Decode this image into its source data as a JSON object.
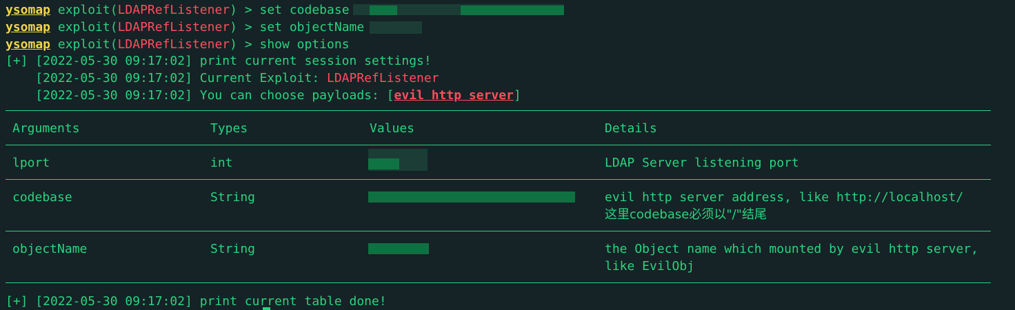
{
  "prompt": "ysomap",
  "commands": [
    {
      "pre": " exploit(",
      "module": "LDAPRefListener",
      "post": ") > set codebase"
    },
    {
      "pre": " exploit(",
      "module": "LDAPRefListener",
      "post": ") > set objectName"
    },
    {
      "pre": " exploit(",
      "module": "LDAPRefListener",
      "post": ") > show options"
    }
  ],
  "log": {
    "line1": "[+] [2022-05-30 09:17:02] print current session settings!",
    "line2_prefix": "    [2022-05-30 09:17:02] Current Exploit: ",
    "line2_value": "LDAPRefListener",
    "line3_prefix": "    [2022-05-30 09:17:02] You can choose payloads: [",
    "line3_value": "evil http server",
    "line3_suffix": "]",
    "done": "[+] [2022-05-30 09:17:02] print current table done!"
  },
  "table": {
    "headers": [
      "Arguments",
      "Types",
      "Values",
      "Details"
    ],
    "rows": [
      {
        "argument": "lport",
        "type": "int",
        "details": [
          "LDAP Server listening port"
        ]
      },
      {
        "argument": "codebase",
        "type": "String",
        "details": [
          "evil http server address, like http://localhost/",
          "这里codebase必须以\"/\"结尾"
        ]
      },
      {
        "argument": "objectName",
        "type": "String",
        "details": [
          "the Object name which mounted by evil http server,",
          "like EvilObj"
        ]
      }
    ]
  },
  "colors": {
    "background": "#152226",
    "text": "#2ad47f",
    "prompt": "#f2d64b",
    "highlight": "#ff4d5e"
  }
}
